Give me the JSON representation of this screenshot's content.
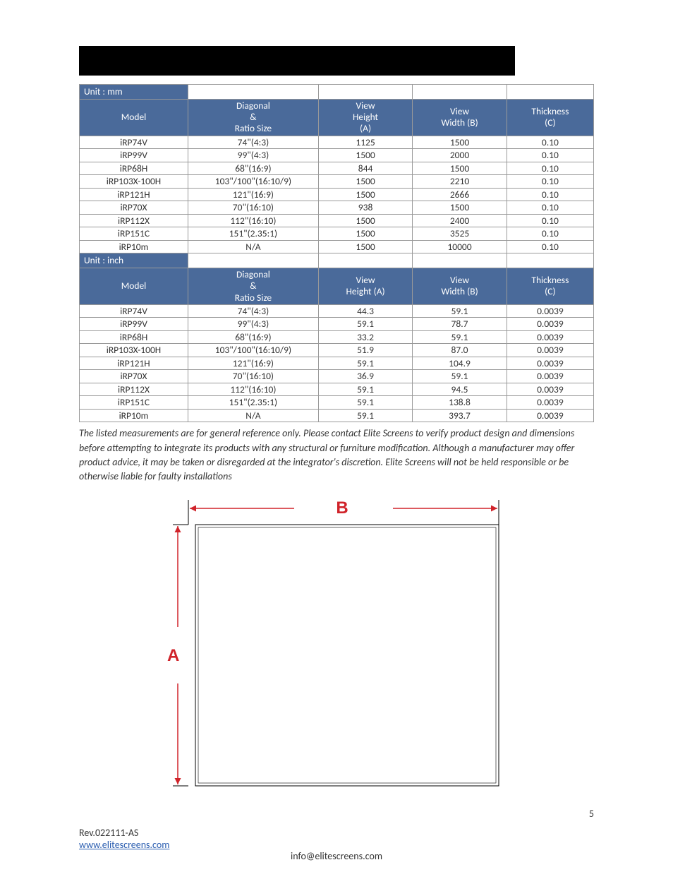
{
  "tables": [
    {
      "unit": "Unit : mm",
      "headers": [
        "Model",
        "Diagonal\n&\nRatio Size",
        "View\nHeight\n(A)",
        "View\nWidth (B)",
        "Thickness\n(C)"
      ],
      "rows": [
        [
          "iRP74V",
          "74\"(4:3)",
          "1125",
          "1500",
          "0.10"
        ],
        [
          "iRP99V",
          "99\"(4:3)",
          "1500",
          "2000",
          "0.10"
        ],
        [
          "iRP68H",
          "68\"(16:9)",
          "844",
          "1500",
          "0.10"
        ],
        [
          "iRP103X-100H",
          "103\"/100\"(16:10/9)",
          "1500",
          "2210",
          "0.10"
        ],
        [
          "iRP121H",
          "121\"(16:9)",
          "1500",
          "2666",
          "0.10"
        ],
        [
          "iRP70X",
          "70\"(16:10)",
          "938",
          "1500",
          "0.10"
        ],
        [
          "iRP112X",
          "112\"(16:10)",
          "1500",
          "2400",
          "0.10"
        ],
        [
          "iRP151C",
          "151\"(2.35:1)",
          "1500",
          "3525",
          "0.10"
        ],
        [
          "iRP10m",
          "N/A",
          "1500",
          "10000",
          "0.10"
        ]
      ]
    },
    {
      "unit": "Unit : inch",
      "headers": [
        "Model",
        "Diagonal\n&\nRatio Size",
        "View\nHeight (A)",
        "View\nWidth (B)",
        "Thickness\n(C)"
      ],
      "rows": [
        [
          "iRP74V",
          "74\"(4:3)",
          "44.3",
          "59.1",
          "0.0039"
        ],
        [
          "iRP99V",
          "99\"(4:3)",
          "59.1",
          "78.7",
          "0.0039"
        ],
        [
          "iRP68H",
          "68\"(16:9)",
          "33.2",
          "59.1",
          "0.0039"
        ],
        [
          "iRP103X-100H",
          "103\"/100\"(16:10/9)",
          "51.9",
          "87.0",
          "0.0039"
        ],
        [
          "iRP121H",
          "121\"(16:9)",
          "59.1",
          "104.9",
          "0.0039"
        ],
        [
          "iRP70X",
          "70\"(16:10)",
          "36.9",
          "59.1",
          "0.0039"
        ],
        [
          "iRP112X",
          "112\"(16:10)",
          "59.1",
          "94.5",
          "0.0039"
        ],
        [
          "iRP151C",
          "151\"(2.35:1)",
          "59.1",
          "138.8",
          "0.0039"
        ],
        [
          "iRP10m",
          "N/A",
          "59.1",
          "393.7",
          "0.0039"
        ]
      ]
    }
  ],
  "disclaimer": "The listed measurements are for general reference only.  Please contact Elite Screens to verify product design and dimensions before attempting to integrate its products with any structural or furniture modification.  Although a manufacturer may offer product advice, it may be taken or disregarded at the integrator's discretion. Elite Screens will not be held responsible or be otherwise liable for faulty installations",
  "diagram": {
    "a_label": "A",
    "b_label": "B"
  },
  "footer": {
    "page_num": "5",
    "rev": "Rev.022111-AS",
    "link": "www.elitescreens.com",
    "email": "info@elitescreens.com"
  }
}
